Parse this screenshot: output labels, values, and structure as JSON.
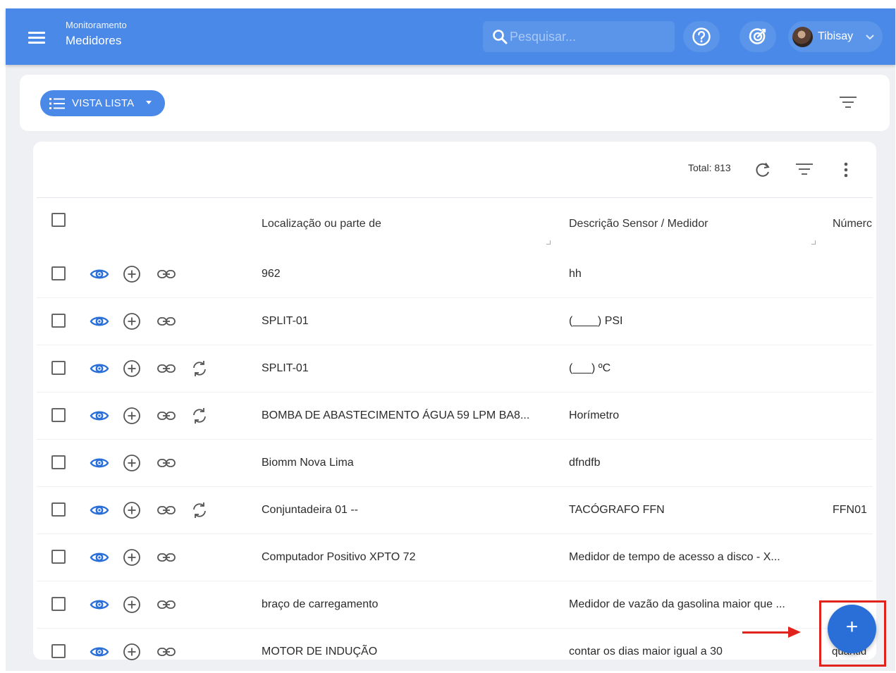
{
  "header": {
    "section": "Monitoramento",
    "title": "Medidores",
    "search_placeholder": "Pesquisar...",
    "user_name": "Tibisay"
  },
  "view_button": {
    "label": "VISTA LISTA"
  },
  "table": {
    "total_label": "Total: 813",
    "columns": [
      "Localização ou parte de",
      "Descrição Sensor / Medidor",
      "Númerc"
    ],
    "rows": [
      {
        "location": "962",
        "description": "hh",
        "number": "",
        "sync": false
      },
      {
        "location": "SPLIT-01",
        "description": "(____) PSI",
        "number": "",
        "sync": false
      },
      {
        "location": "SPLIT-01",
        "description": "(___) ºC",
        "number": "",
        "sync": true
      },
      {
        "location": "BOMBA DE ABASTECIMENTO ÁGUA 59 LPM BA8...",
        "description": "Horímetro",
        "number": "",
        "sync": true
      },
      {
        "location": "Biomm Nova Lima",
        "description": "dfndfb",
        "number": "",
        "sync": false
      },
      {
        "location": "Conjuntadeira 01 --",
        "description": "TACÓGRAFO FFN",
        "number": "FFN01",
        "sync": true
      },
      {
        "location": "Computador Positivo XPTO 72",
        "description": "Medidor de tempo de acesso a disco - X...",
        "number": "",
        "sync": false
      },
      {
        "location": "braço de carregamento",
        "description": "Medidor de vazão da gasolina maior que ...",
        "number": "",
        "sync": false
      },
      {
        "location": "MOTOR DE INDUÇÃO",
        "description": "contar os dias maior igual a 30",
        "number": "quantid",
        "sync": false
      }
    ]
  },
  "fab": {
    "label": "+"
  },
  "colors": {
    "topbar": "#4a89e8",
    "accent": "#2a6fd8",
    "highlight": "#e0231c",
    "icon_blue": "#2a6fd8"
  },
  "icons": {
    "menu": "menu-icon",
    "search": "search-icon",
    "help": "help-icon",
    "feedback": "target-icon",
    "list": "list-icon",
    "filter": "filter-icon",
    "refresh": "refresh-icon",
    "more": "more-vert-icon",
    "view": "eye-icon",
    "add": "plus-circle-icon",
    "link": "link-icon",
    "sync": "sync-icon"
  }
}
